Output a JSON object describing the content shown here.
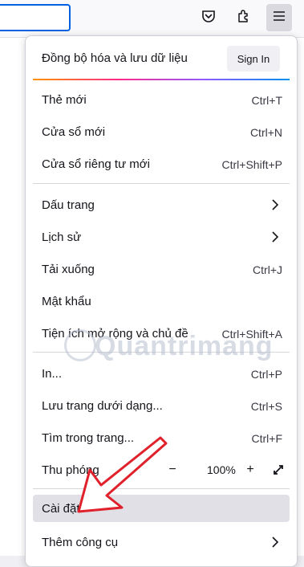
{
  "colors": {
    "accent": "#0061e0",
    "menu_bg": "#ffffff",
    "toolbar_bg": "#f9f9fb",
    "arrow": "#e0202a"
  },
  "toolbar": {
    "icons": [
      "pocket-icon",
      "extensions-icon",
      "menu-icon"
    ]
  },
  "sync": {
    "title": "Đồng bộ hóa và lưu dữ liệu",
    "signin_label": "Sign In"
  },
  "menu": {
    "new_tab": {
      "label": "Thẻ mới",
      "shortcut": "Ctrl+T"
    },
    "new_window": {
      "label": "Cửa sổ mới",
      "shortcut": "Ctrl+N"
    },
    "private_window": {
      "label": "Cửa sổ riêng tư mới",
      "shortcut": "Ctrl+Shift+P"
    },
    "bookmarks": {
      "label": "Dấu trang"
    },
    "history": {
      "label": "Lịch sử"
    },
    "downloads": {
      "label": "Tải xuống",
      "shortcut": "Ctrl+J"
    },
    "passwords": {
      "label": "Mật khẩu"
    },
    "addons": {
      "label": "Tiện ích mở rộng và chủ đề",
      "shortcut": "Ctrl+Shift+A"
    },
    "print": {
      "label": "In...",
      "shortcut": "Ctrl+P"
    },
    "save_page": {
      "label": "Lưu trang dưới dạng...",
      "shortcut": "Ctrl+S"
    },
    "find": {
      "label": "Tìm trong trang...",
      "shortcut": "Ctrl+F"
    },
    "zoom": {
      "label": "Thu phóng",
      "minus": "−",
      "value": "100%",
      "plus": "+"
    },
    "settings": {
      "label": "Cài đặt"
    },
    "more_tools": {
      "label": "Thêm công cụ"
    }
  },
  "watermark": {
    "text": "Quantrimang"
  }
}
